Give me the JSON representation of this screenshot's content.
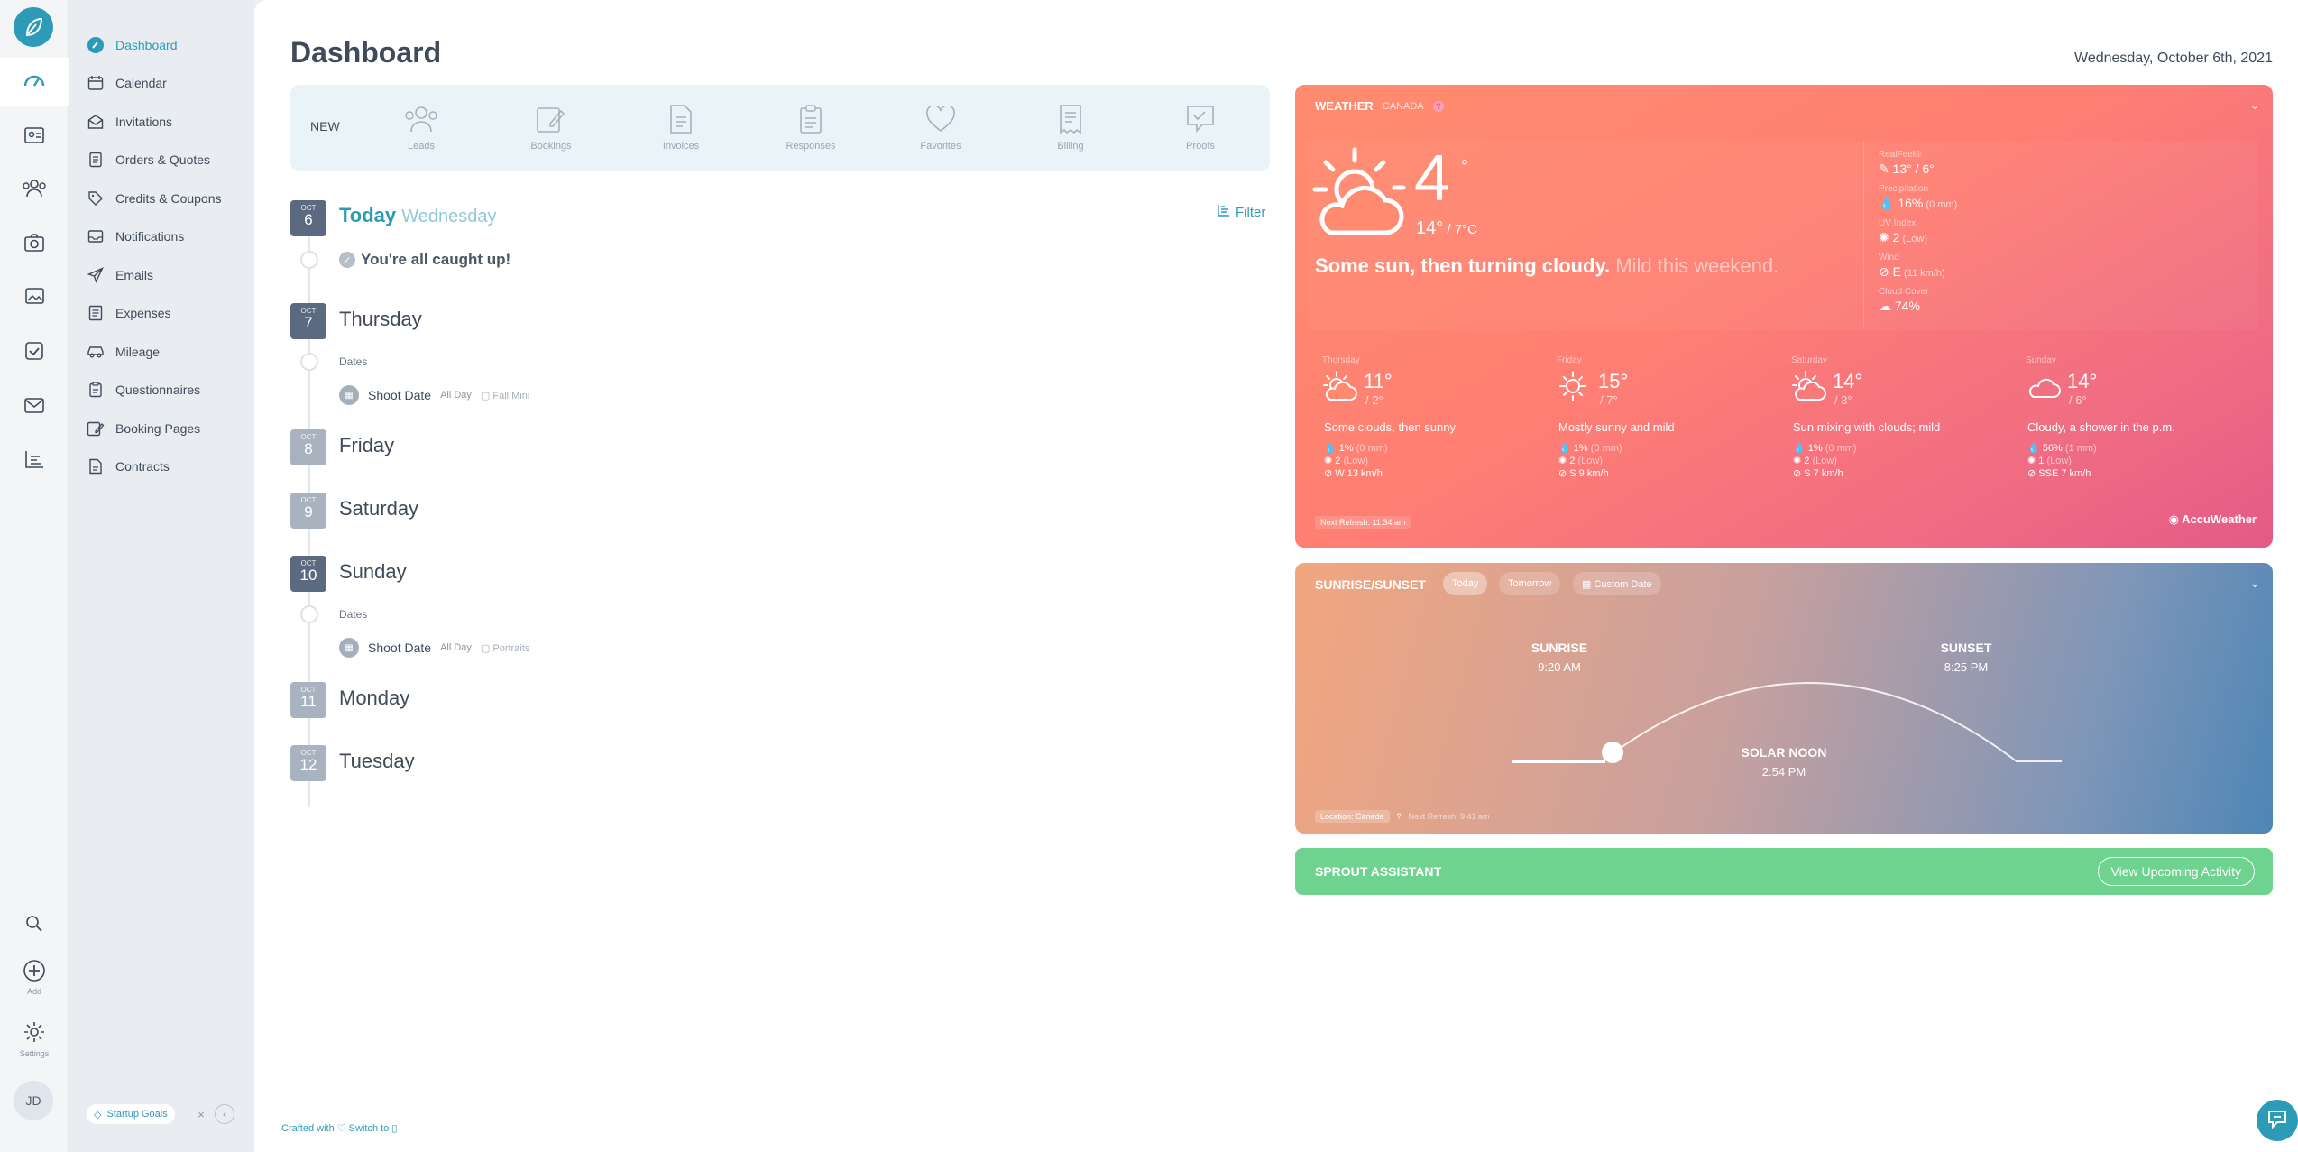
{
  "rail": {
    "add_caption": "Add",
    "settings_caption": "Settings",
    "avatar_initials": "JD"
  },
  "sidebar": {
    "items": [
      {
        "label": "Dashboard",
        "icon": "dashboard-icon",
        "active": true
      },
      {
        "label": "Calendar",
        "icon": "calendar-icon"
      },
      {
        "label": "Invitations",
        "icon": "envelope-icon"
      },
      {
        "label": "Orders & Quotes",
        "icon": "orders-icon"
      },
      {
        "label": "Credits & Coupons",
        "icon": "tag-icon"
      },
      {
        "label": "Notifications",
        "icon": "inbox-icon"
      },
      {
        "label": "Emails",
        "icon": "paper-plane-icon"
      },
      {
        "label": "Expenses",
        "icon": "receipt-icon"
      },
      {
        "label": "Mileage",
        "icon": "car-icon"
      },
      {
        "label": "Questionnaires",
        "icon": "clipboard-icon"
      },
      {
        "label": "Booking Pages",
        "icon": "booking-icon"
      },
      {
        "label": "Contracts",
        "icon": "contract-icon"
      }
    ],
    "goals_label": "Startup Goals",
    "goals_close": "×",
    "collapse": "‹"
  },
  "header": {
    "title": "Dashboard",
    "date": "Wednesday, October 6th, 2021"
  },
  "newbar": {
    "label": "NEW",
    "items": [
      "Leads",
      "Bookings",
      "Invoices",
      "Responses",
      "Favorites",
      "Billing",
      "Proofs"
    ]
  },
  "timeline": {
    "filter_label": "Filter",
    "today_title": "Today",
    "today_sub": "Wednesday",
    "caught_up": "You're all caught up!",
    "days": [
      {
        "month": "OCT",
        "day": "6"
      },
      {
        "month": "OCT",
        "day": "7",
        "name": "Thursday"
      },
      {
        "month": "OCT",
        "day": "8",
        "name": "Friday"
      },
      {
        "month": "OCT",
        "day": "9",
        "name": "Saturday"
      },
      {
        "month": "OCT",
        "day": "10",
        "name": "Sunday"
      },
      {
        "month": "OCT",
        "day": "11",
        "name": "Monday"
      },
      {
        "month": "OCT",
        "day": "12",
        "name": "Tuesday"
      }
    ],
    "dates_label": "Dates",
    "events": [
      {
        "title": "Shoot Date",
        "when": "All Day",
        "tag": "Fall Mini"
      },
      {
        "title": "Shoot Date",
        "when": "All Day",
        "tag": "Portraits"
      }
    ]
  },
  "footer": {
    "crafted": "Crafted with ♡  Switch to ▯"
  },
  "weather": {
    "title": "WEATHER",
    "location": "CANADA",
    "help": "?",
    "chevron": "⌄",
    "temp": "4",
    "deg": "°",
    "hilo_hi": "14°",
    "hilo_lo": " / 7°C",
    "desc_main": "Some sun, then turning cloudy.",
    "desc_sub": " Mild this weekend.",
    "stats": [
      {
        "label": "RealFeel®",
        "value": "13° / 6°",
        "extra": ""
      },
      {
        "label": "Precipitation",
        "value": "16%",
        "extra": " (0 mm)"
      },
      {
        "label": "UV Index",
        "value": "2",
        "extra": " (Low)"
      },
      {
        "label": "Wind",
        "value": "E",
        "extra": " (11 km/h)"
      },
      {
        "label": "Cloud Cover",
        "value": "74%",
        "extra": ""
      }
    ],
    "forecast": [
      {
        "day": "Thursday",
        "hi": "11°",
        "lo": "/ 2°",
        "desc": "Some clouds, then sunny",
        "precip": "1%",
        "precip_mm": " (0 mm)",
        "uv": "2",
        "uv_txt": " (Low)",
        "wind": "W 13 km/h",
        "icon": "sun-cloud-icon"
      },
      {
        "day": "Friday",
        "hi": "15°",
        "lo": "/ 7°",
        "desc": "Mostly sunny and mild",
        "precip": "1%",
        "precip_mm": " (0 mm)",
        "uv": "2",
        "uv_txt": " (Low)",
        "wind": "S 9 km/h",
        "icon": "sun-icon"
      },
      {
        "day": "Saturday",
        "hi": "14°",
        "lo": "/ 3°",
        "desc": "Sun mixing with clouds; mild",
        "precip": "1%",
        "precip_mm": " (0 mm)",
        "uv": "2",
        "uv_txt": " (Low)",
        "wind": "S 7 km/h",
        "icon": "sun-cloud-icon"
      },
      {
        "day": "Sunday",
        "hi": "14°",
        "lo": "/ 6°",
        "desc": "Cloudy, a shower in the p.m.",
        "precip": "56%",
        "precip_mm": " (1 mm)",
        "uv": "1",
        "uv_txt": " (Low)",
        "wind": "SSE 7 km/h",
        "icon": "cloud-icon"
      }
    ],
    "refresh": "Next Refresh: 11:34 am",
    "brand": "◉ AccuWeather"
  },
  "sun": {
    "title": "SUNRISE/SUNSET",
    "tabs": [
      "Today",
      "Tomorrow",
      "▦ Custom Date"
    ],
    "chevron": "⌄",
    "sunrise_label": "SUNRISE",
    "sunrise_time": "9:20 AM",
    "sunset_label": "SUNSET",
    "sunset_time": "8:25 PM",
    "noon_label": "SOLAR NOON",
    "noon_time": "2:54 PM",
    "location": "Location: Canada",
    "help": "?",
    "refresh": "Next Refresh: 9:41 am"
  },
  "assistant": {
    "title": "SPROUT ASSISTANT",
    "button": "View Upcoming Activity"
  }
}
